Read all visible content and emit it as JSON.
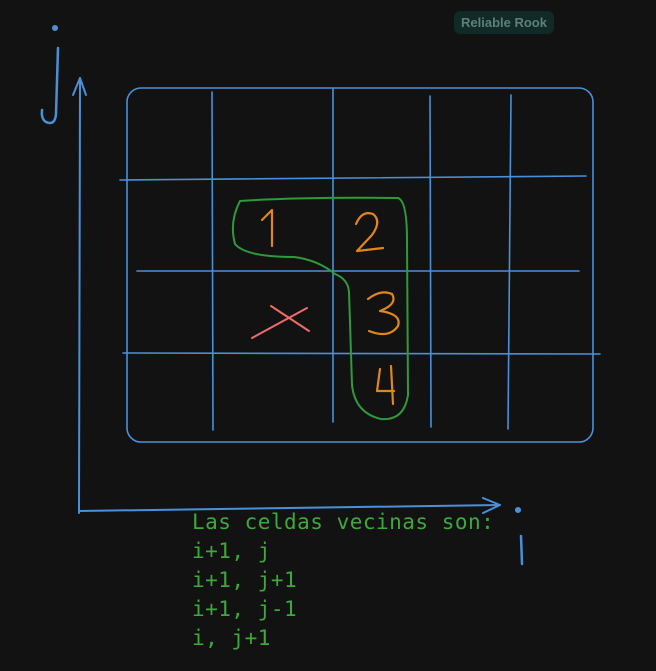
{
  "collaborator_badge": "Reliable Rook",
  "axis_labels": {
    "vertical": "j",
    "horizontal": "i"
  },
  "cell_labels": [
    "1",
    "2",
    "3",
    "4"
  ],
  "current_cell_mark": "×",
  "notes": {
    "heading": "Las celdas vecinas son:",
    "lines": [
      "i+1, j",
      "i+1, j+1",
      "i+1, j-1",
      "i, j+1"
    ]
  },
  "colors": {
    "background": "#121212",
    "grid": "#4a90d9",
    "axes": "#4a90d9",
    "highlight": "#2f9a3a",
    "labels": "#e0861b",
    "cross": "#ef6b6b",
    "notes": "#3ea83b"
  }
}
